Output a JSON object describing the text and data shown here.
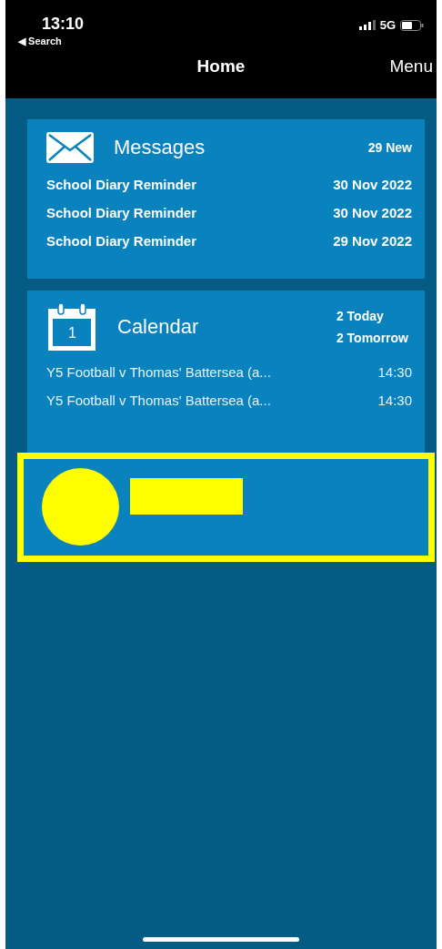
{
  "status_bar": {
    "time": "13:10",
    "back_label": "◀ Search",
    "network": "5G"
  },
  "nav_bar": {
    "title": "Home",
    "menu": "Menu"
  },
  "messages": {
    "title": "Messages",
    "count": "29 New",
    "items": [
      {
        "subject": "School Diary Reminder",
        "date": "30 Nov 2022"
      },
      {
        "subject": "School Diary Reminder",
        "date": "30 Nov 2022"
      },
      {
        "subject": "School Diary Reminder",
        "date": "29 Nov 2022"
      }
    ]
  },
  "calendar": {
    "title": "Calendar",
    "day": "1",
    "today": "2 Today",
    "tomorrow": "2 Tomorrow",
    "events": [
      {
        "title": "Y5 Football v Thomas' Battersea (a...",
        "time": "14:30"
      },
      {
        "title": "Y5 Football v Thomas' Battersea (a...",
        "time": "14:30"
      }
    ]
  },
  "redacted_card": {
    "kind": "redacted"
  }
}
